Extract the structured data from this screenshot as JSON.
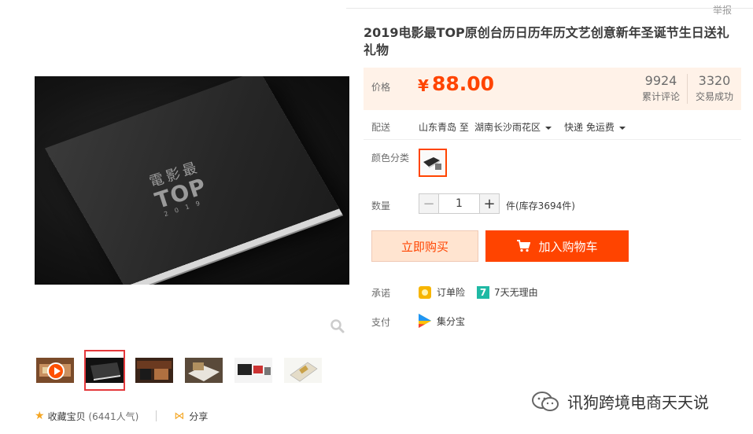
{
  "header": {
    "report_label": "举报"
  },
  "product": {
    "title": "2019电影最TOP原创台历日历年历文艺创意新年圣诞节生日送礼礼物",
    "price_label": "价格",
    "price_currency": "¥",
    "price_value": "88.00",
    "stats": [
      {
        "value": "9924",
        "label": "累计评论"
      },
      {
        "value": "3320",
        "label": "交易成功"
      }
    ]
  },
  "gallery": {
    "main_image_text": {
      "line1": "電影最",
      "line2": "TOP",
      "line3": "2019"
    },
    "thumbnails": [
      "video-thumbnail",
      "calendar-box-thumbnail",
      "calendar-display-thumbnail",
      "calendar-open-thumbnail",
      "calendar-set-thumbnail",
      "calendar-page-thumbnail"
    ],
    "active_thumbnail_index": 1
  },
  "shipping": {
    "label": "配送",
    "origin": "山东青岛 至",
    "destination": "湖南长沙雨花区",
    "method": "快递 免运费"
  },
  "color": {
    "label": "颜色分类"
  },
  "quantity": {
    "label": "数量",
    "minus": "−",
    "value": "1",
    "plus": "+",
    "unit_stock": "件(库存3694件)"
  },
  "actions": {
    "buy_now": "立即购买",
    "add_to_cart": "加入购物车"
  },
  "promise": {
    "label": "承诺",
    "items": [
      {
        "icon": "insurance-icon",
        "text": "订单险"
      },
      {
        "icon": "seven-day-return-icon",
        "text": "7天无理由",
        "badge": "7"
      }
    ]
  },
  "payment": {
    "label": "支付",
    "method": "集分宝"
  },
  "footer": {
    "favorite_label": "收藏宝贝",
    "favorite_count": "(6441人气)",
    "share_label": "分享"
  },
  "watermark": {
    "text": "讯狗跨境电商天天说"
  },
  "colors": {
    "accent": "#ff4400",
    "price_bg": "#fff2e8",
    "buy_now_bg": "#ffe4d0",
    "thumb_active_border": "#e4393c"
  }
}
